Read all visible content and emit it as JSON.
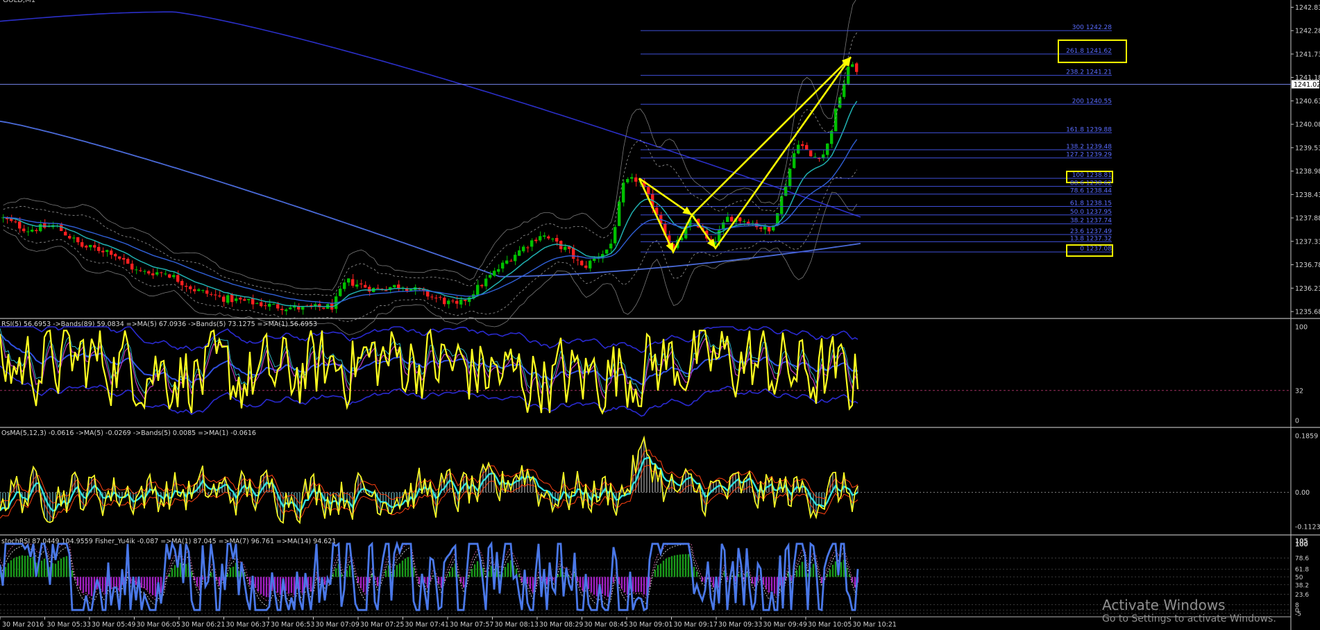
{
  "app": {
    "title_partial": "GOLD,M1"
  },
  "chart_data": {
    "type": "line",
    "instrument_header": "GOLD,M1",
    "price_panel": {
      "y_ticks": [
        1242.83,
        1242.28,
        1241.73,
        1241.18,
        1240.63,
        1240.08,
        1239.53,
        1238.98,
        1238.43,
        1237.88,
        1237.33,
        1236.78,
        1236.23,
        1235.68
      ],
      "current_price": "1241.02",
      "fib_levels": [
        {
          "ratio": "300",
          "value": "1242.28",
          "level": 1242.28,
          "boxed": false
        },
        {
          "ratio": "261.8",
          "value": "1241.62",
          "level": 1241.73,
          "boxed": true
        },
        {
          "ratio": "238.2",
          "value": "1241.21",
          "level": 1241.23,
          "boxed": false
        },
        {
          "ratio": "200",
          "value": "1240.55",
          "level": 1240.55,
          "boxed": false
        },
        {
          "ratio": "161.8",
          "value": "1239.88",
          "level": 1239.88,
          "boxed": false
        },
        {
          "ratio": "138.2",
          "value": "1239.48",
          "level": 1239.48,
          "boxed": false
        },
        {
          "ratio": "127.2",
          "value": "1239.29",
          "level": 1239.29,
          "boxed": false
        },
        {
          "ratio": "100",
          "value": "1238.81",
          "level": 1238.81,
          "boxed": true
        },
        {
          "ratio": "88.6",
          "value": "1238.62",
          "level": 1238.62,
          "boxed": false
        },
        {
          "ratio": "78.6",
          "value": "1238.44",
          "level": 1238.44,
          "boxed": false
        },
        {
          "ratio": "61.8",
          "value": "1238.15",
          "level": 1238.15,
          "boxed": false
        },
        {
          "ratio": "50.0",
          "value": "1237.95",
          "level": 1237.95,
          "boxed": false
        },
        {
          "ratio": "38.2",
          "value": "1237.74",
          "level": 1237.74,
          "boxed": false
        },
        {
          "ratio": "23.6",
          "value": "1237.49",
          "level": 1237.49,
          "boxed": false
        },
        {
          "ratio": "13.8",
          "value": "1237.32",
          "level": 1237.32,
          "boxed": false
        },
        {
          "ratio": "0",
          "value": "1237.08",
          "level": 1237.08,
          "boxed": true
        }
      ],
      "pattern_points": [
        {
          "time_index": 47,
          "price": 1238.81
        },
        {
          "time_index": 48,
          "price": 1237.08
        },
        {
          "time_index": 49,
          "price": 1237.95
        },
        {
          "time_index": 50,
          "price": 1237.17
        },
        {
          "time_index": 55,
          "price": 1241.66
        }
      ]
    },
    "rsi_panel": {
      "label": "RSI(5) 56.6953  ->Bands(89) 59.0834  =>MA(5) 67.0936  ->Bands(5) 73.1275  =>MA(1) 56.6953",
      "y_ticks": [
        100,
        32,
        0
      ]
    },
    "osma_panel": {
      "label": "OsMA(5,12,3) -0.0616  ->MA(5) -0.0269  ->Bands(5) 0.0085  =>MA(1) -0.0616",
      "y_ticks": [
        "0.1859",
        "0.00",
        "-0.1123"
      ]
    },
    "stoch_panel": {
      "label": "stochRSI 87.0449 104.9559  Fisher_Yu4ik -0.087  =>MA(1) 87.045  =>MA(7) 96.761  =>MA(14) 94.621",
      "y_ticks": [
        "105",
        "100",
        "78.6",
        "61.8",
        "50",
        "38.2",
        "23.6",
        "8",
        "0",
        "-5"
      ]
    },
    "x_ticks": [
      "30 Mar 2016",
      "30 Mar 05:33",
      "30 Mar 05:49",
      "30 Mar 06:05",
      "30 Mar 06:21",
      "30 Mar 06:37",
      "30 Mar 06:53",
      "30 Mar 07:09",
      "30 Mar 07:25",
      "30 Mar 07:41",
      "30 Mar 07:57",
      "30 Mar 08:13",
      "30 Mar 08:29",
      "30 Mar 08:45",
      "30 Mar 09:01",
      "30 Mar 09:17",
      "30 Mar 09:33",
      "30 Mar 09:49",
      "30 Mar 10:05",
      "30 Mar 10:21"
    ]
  },
  "watermark": {
    "line1": "Activate Windows",
    "line2": "Go to Settings to activate Windows."
  }
}
